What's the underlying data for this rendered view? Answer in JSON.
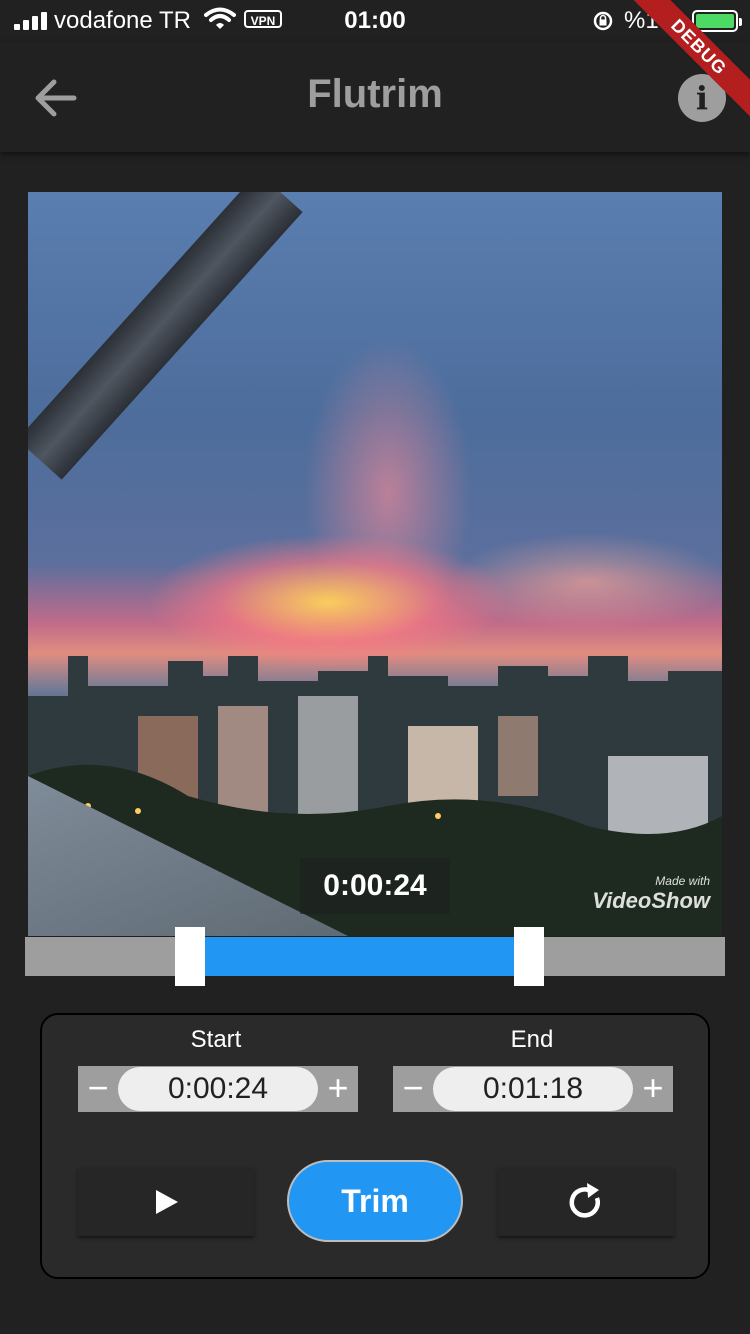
{
  "status_bar": {
    "carrier": "vodafone TR",
    "vpn": "VPN",
    "time": "01:00",
    "battery": "%100",
    "battery_level": 1.0,
    "battery_color": "#4cd964"
  },
  "debug_banner": "DEBUG",
  "app_bar": {
    "back_icon": "arrow-left-icon",
    "title": "Flutrim",
    "info_icon": "info-icon",
    "info_glyph": "i"
  },
  "video": {
    "current_time": "0:00:24",
    "watermark_small": "Made with",
    "watermark_brand": "VideoShow"
  },
  "trimmer": {
    "start_fraction": 0.235,
    "end_fraction": 0.72,
    "range_color": "#2196f3",
    "track_color": "#9e9e9e"
  },
  "controls": {
    "start_label": "Start",
    "start_value": "0:00:24",
    "end_label": "End",
    "end_value": "0:01:18",
    "minus_glyph": "−",
    "plus_glyph": "+",
    "play_icon": "play-icon",
    "trim_label": "Trim",
    "reset_icon": "refresh-icon"
  }
}
